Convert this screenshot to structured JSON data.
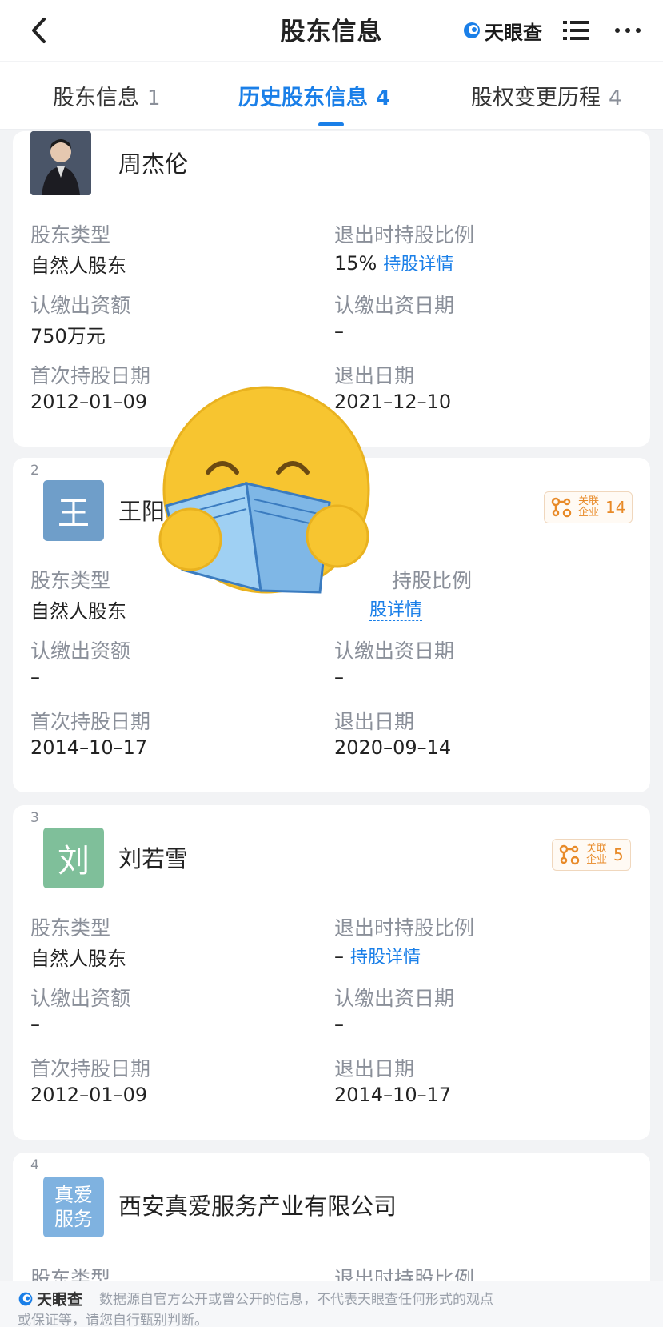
{
  "header": {
    "title": "股东信息",
    "brand": "天眼查"
  },
  "tabs": [
    {
      "label": "股东信息",
      "count": "1"
    },
    {
      "label": "历史股东信息",
      "count": "4"
    },
    {
      "label": "股权变更历程",
      "count": "4"
    }
  ],
  "shareholders": [
    {
      "name": "周杰伦",
      "labels": {
        "type": "股东类型",
        "ratio": "退出时持股比例",
        "amount": "认缴出资额",
        "contrib_date": "认缴出资日期",
        "first_date": "首次持股日期",
        "exit_date": "退出日期"
      },
      "type": "自然人股东",
      "ratio": "15%",
      "detail_link": "持股详情",
      "amount": "750万元",
      "contrib_date": "–",
      "first_date": "2012–01–09",
      "exit_date": "2021–12–10"
    },
    {
      "index": "2",
      "avatar": "王",
      "avatar_color": "#6f9ec9",
      "name": "王阳",
      "badge_label": "关联企业",
      "badge_count": "14",
      "labels": {
        "type": "股东类型",
        "ratio": "持股比例",
        "amount": "认缴出资额",
        "contrib_date": "认缴出资日期",
        "first_date": "首次持股日期",
        "exit_date": "退出日期"
      },
      "type": "自然人股东",
      "detail_link": "股详情",
      "amount": "–",
      "contrib_date": "–",
      "first_date": "2014–10–17",
      "exit_date": "2020–09–14"
    },
    {
      "index": "3",
      "avatar": "刘",
      "avatar_color": "#7fbf9a",
      "name": "刘若雪",
      "badge_label": "关联企业",
      "badge_count": "5",
      "labels": {
        "type": "股东类型",
        "ratio": "退出时持股比例",
        "amount": "认缴出资额",
        "contrib_date": "认缴出资日期",
        "first_date": "首次持股日期",
        "exit_date": "退出日期"
      },
      "type": "自然人股东",
      "ratio": "–",
      "detail_link": "持股详情",
      "amount": "–",
      "contrib_date": "–",
      "first_date": "2012–01–09",
      "exit_date": "2014–10–17"
    },
    {
      "index": "4",
      "avatar_line1": "真爱",
      "avatar_line2": "服务",
      "avatar_color": "#7fb2e0",
      "name": "西安真爱服务产业有限公司",
      "labels": {
        "type": "股东类型",
        "ratio": "退出时持股比例"
      }
    }
  ],
  "footer": {
    "brand": "天眼查",
    "text_line1": "数据源自官方公开或曾公开的信息，不代表天眼查任何形式的观点",
    "text_line2": "或保证等，请您自行甄别判断。"
  },
  "colors": {
    "accent": "#1a7fe8",
    "badge": "#e88a28",
    "emoji_face": "#f7c530",
    "book": "#7fb7e6"
  }
}
